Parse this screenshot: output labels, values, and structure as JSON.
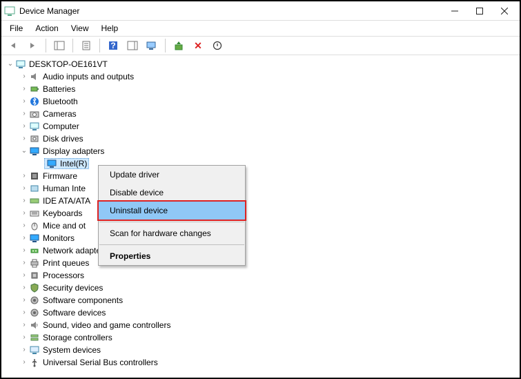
{
  "window": {
    "title": "Device Manager"
  },
  "menu": {
    "file": "File",
    "action": "Action",
    "view": "View",
    "help": "Help"
  },
  "tree": {
    "root": "DESKTOP-OE161VT",
    "items": [
      {
        "label": "Audio inputs and outputs"
      },
      {
        "label": "Batteries"
      },
      {
        "label": "Bluetooth"
      },
      {
        "label": "Cameras"
      },
      {
        "label": "Computer"
      },
      {
        "label": "Disk drives"
      },
      {
        "label": "Display adapters",
        "expanded": true,
        "children": [
          {
            "label": "Intel(R) "
          }
        ]
      },
      {
        "label": "Firmware"
      },
      {
        "label": "Human Inte"
      },
      {
        "label": "IDE ATA/ATA"
      },
      {
        "label": "Keyboards"
      },
      {
        "label": "Mice and ot"
      },
      {
        "label": "Monitors"
      },
      {
        "label": "Network adapters"
      },
      {
        "label": "Print queues"
      },
      {
        "label": "Processors"
      },
      {
        "label": "Security devices"
      },
      {
        "label": "Software components"
      },
      {
        "label": "Software devices"
      },
      {
        "label": "Sound, video and game controllers"
      },
      {
        "label": "Storage controllers"
      },
      {
        "label": "System devices"
      },
      {
        "label": "Universal Serial Bus controllers"
      }
    ]
  },
  "context_menu": {
    "update": "Update driver",
    "disable": "Disable device",
    "uninstall": "Uninstall device",
    "scan": "Scan for hardware changes",
    "properties": "Properties"
  }
}
